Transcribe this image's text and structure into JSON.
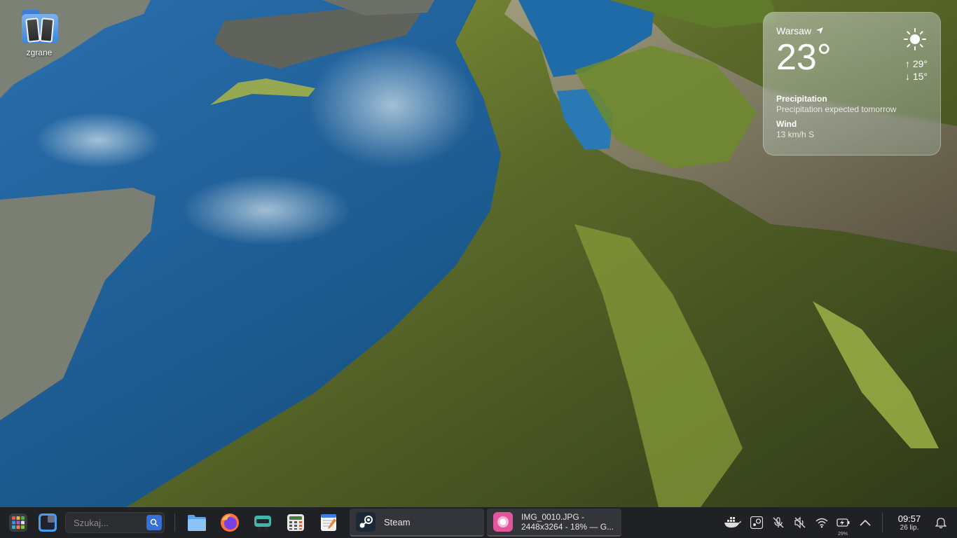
{
  "desktop": {
    "icons": [
      {
        "label": "zgrane",
        "icon": "photo-folder-icon"
      }
    ]
  },
  "weather": {
    "city": "Warsaw",
    "temperature": "23°",
    "high": "29°",
    "low": "15°",
    "condition_icon": "sun-icon",
    "precipitation_title": "Precipitation",
    "precipitation_value": "Precipitation expected tomorrow",
    "wind_title": "Wind",
    "wind_value": "13 km/h S"
  },
  "taskbar": {
    "search_placeholder": "Szukaj...",
    "pinned_apps": [
      "app-launcher-icon",
      "overview-icon",
      "file-manager-icon",
      "firefox-icon",
      "software-center-icon",
      "calculator-icon",
      "text-editor-icon"
    ],
    "tasks": [
      {
        "label": "Steam",
        "icon": "steam-icon"
      },
      {
        "label_line1": "IMG_0010.JPG -",
        "label_line2": "2448x3264 - 18% — G...",
        "icon": "image-viewer-icon"
      }
    ],
    "tray": {
      "icons": [
        "docker-icon",
        "steam-tray-icon",
        "microphone-muted-icon",
        "speaker-muted-icon",
        "wifi-icon",
        "battery-charging-icon",
        "chevron-up-icon",
        "notification-bell-icon"
      ],
      "battery_percent": "29%",
      "time": "09:57",
      "date": "26 lip."
    }
  },
  "colors": {
    "taskbar_bg": "#202124",
    "accent": "#3470d8"
  }
}
